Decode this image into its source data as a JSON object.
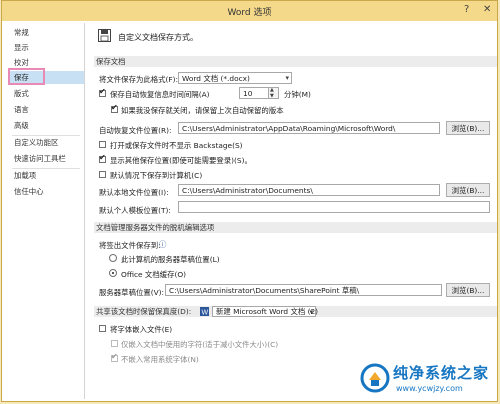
{
  "window": {
    "title": "Word 选项",
    "help_glyph": "?",
    "close_glyph": "✕"
  },
  "sidebar": {
    "items": [
      {
        "label": "常规"
      },
      {
        "label": "显示"
      },
      {
        "label": "校对"
      },
      {
        "label": "保存",
        "active": true
      },
      {
        "label": "版式"
      },
      {
        "label": "语言"
      },
      {
        "label": "高级"
      },
      {
        "label": "自定义功能区"
      },
      {
        "label": "快速访问工具栏"
      },
      {
        "label": "加载项"
      },
      {
        "label": "信任中心"
      }
    ]
  },
  "header": {
    "text": "自定义文档保存方式。"
  },
  "save_docs": {
    "section_title": "保存文档",
    "format_label": "将文件保存为此格式(F):",
    "format_value": "Word 文档 (*.docx)",
    "autorecover_label": "保存自动恢复信息时间间隔(A)",
    "autorecover_minutes": "10",
    "minutes_label": "分钟(M)",
    "keep_last_label": "如果我没保存就关闭，请保留上次自动保留的版本",
    "autorecover_location_label": "自动恢复文件位置(R):",
    "autorecover_location_value": "C:\\Users\\Administrator\\AppData\\Roaming\\Microsoft\\Word\\",
    "browse1": "浏览(B)...",
    "no_backstage_label": "打开或保存文件时不显示 Backstage(S)",
    "show_other_locations_label": "显示其他保存位置(即使可能需要登录)(S)。",
    "save_to_computer_label": "默认情况下保存到计算机(C)",
    "default_local_label": "默认本地文件位置(I):",
    "default_local_value": "C:\\Users\\Administrator\\Documents\\",
    "browse2": "浏览(B)...",
    "personal_templates_label": "默认个人模板位置(T):",
    "personal_templates_value": ""
  },
  "offline": {
    "section_title": "文档管理服务器文件的脱机编辑选项",
    "save_checked_out_label": "将签出文件保存到:",
    "info_glyph": "ⓘ",
    "option_server": "此计算机的服务器草稿位置(L)",
    "option_cache": "Office 文档缓存(O)",
    "server_drafts_label": "服务器草稿位置(V):",
    "server_drafts_value": "C:\\Users\\Administrator\\Documents\\SharePoint 草稿\\",
    "browse3": "浏览(B)..."
  },
  "fidelity": {
    "section_title": "共享该文档时保留保真度(D):",
    "doc_value": "新建 Microsoft Word 文档 (2)",
    "embed_fonts_label": "将字体嵌入文件(E)",
    "embed_used_only_label": "仅嵌入文档中使用的字符(适于减小文件大小)(C)",
    "no_common_fonts_label": "不嵌入常用系统字体(N)"
  },
  "watermark": {
    "text": "纯净系统之家",
    "url": "www.ycwjzy.com"
  },
  "colors": {
    "titlebar": "#f5d98a",
    "active_nav": "#c7e0f4",
    "highlight": "#e98ab6",
    "word_blue": "#2b579a",
    "watermark_blue": "#1676c2"
  }
}
